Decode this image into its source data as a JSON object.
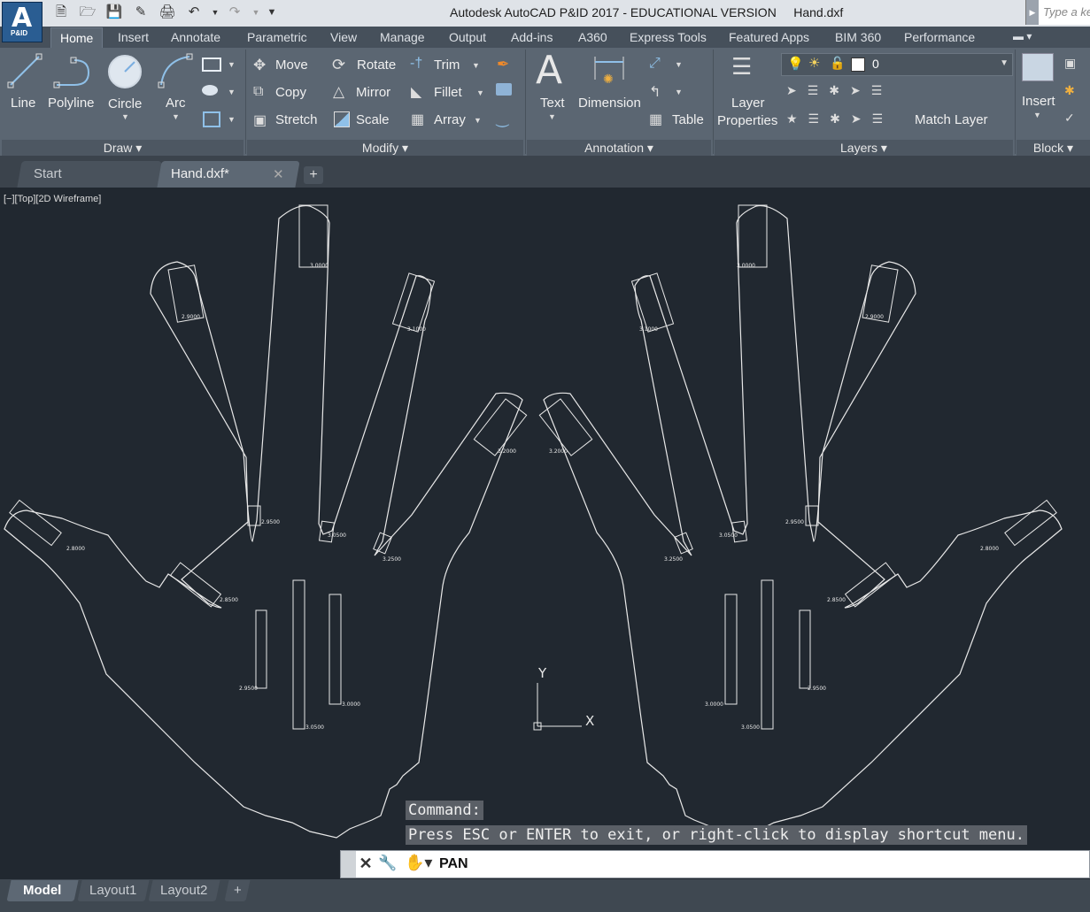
{
  "app": {
    "logo_letter": "A",
    "logo_sub": "P&ID",
    "title": "Autodesk AutoCAD P&ID 2017 - EDUCATIONAL VERSION     Hand.dxf",
    "search_placeholder": "Type a ke"
  },
  "ribbon_tabs": [
    "Home",
    "Insert",
    "Annotate",
    "Parametric",
    "View",
    "Manage",
    "Output",
    "Add-ins",
    "A360",
    "Express Tools",
    "Featured Apps",
    "BIM 360",
    "Performance"
  ],
  "ribbon": {
    "draw": {
      "title": "Draw",
      "line": "Line",
      "polyline": "Polyline",
      "circle": "Circle",
      "arc": "Arc"
    },
    "modify": {
      "title": "Modify",
      "move": "Move",
      "rotate": "Rotate",
      "trim": "Trim",
      "copy": "Copy",
      "mirror": "Mirror",
      "fillet": "Fillet",
      "stretch": "Stretch",
      "scale": "Scale",
      "array": "Array"
    },
    "annotation": {
      "title": "Annotation",
      "text": "Text",
      "dimension": "Dimension",
      "table": "Table"
    },
    "layers": {
      "title": "Layers",
      "layer_properties_1": "Layer",
      "layer_properties_2": "Properties",
      "current_layer": "0",
      "match_layer": "Match Layer"
    },
    "block": {
      "title": "Block",
      "insert": "Insert"
    }
  },
  "doc_tabs": {
    "start": "Start",
    "active": "Hand.dxf*"
  },
  "viewport": {
    "label": "[−][Top][2D Wireframe]"
  },
  "drawing": {
    "ucs": {
      "x": "X",
      "y": "Y"
    },
    "labels_left": [
      "3.0000",
      "2.9000",
      "3.1000",
      "3.2000",
      "2.9500",
      "3.0500",
      "3.2500",
      "2.8000",
      "2.8500",
      "2.9500",
      "3.0500",
      "3.0000"
    ],
    "labels_right": [
      "3.0000",
      "2.9000",
      "3.1000",
      "3.2000",
      "2.9500",
      "3.0500",
      "3.2500",
      "2.8000",
      "2.8500",
      "2.9500",
      "3.0500",
      "3.0000"
    ]
  },
  "command": {
    "history_1": "Command:",
    "history_2": "Press ESC or ENTER to exit, or right-click to display shortcut menu.",
    "current": "PAN"
  },
  "layout_tabs": [
    "Model",
    "Layout1",
    "Layout2"
  ]
}
